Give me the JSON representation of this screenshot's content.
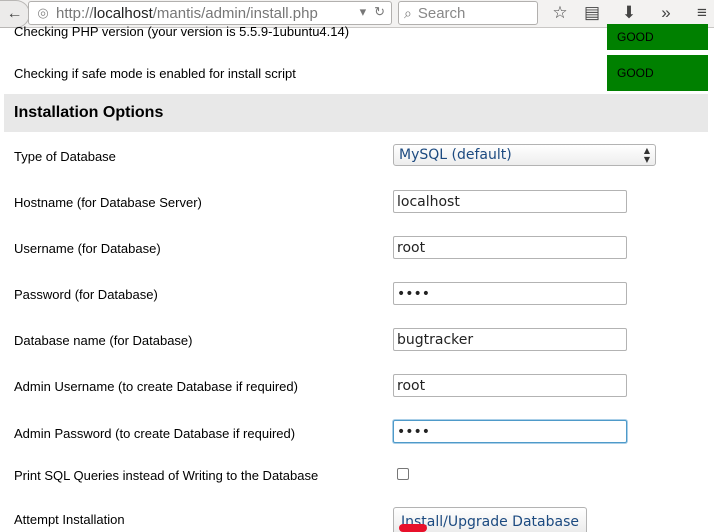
{
  "browser": {
    "url_prefix": "http://",
    "url_host": "localhost",
    "url_path": "/mantis/admin/install.php",
    "search_placeholder": "Search"
  },
  "checks": [
    {
      "label": "Checking PHP version (your version is 5.5.9-1ubuntu4.14)",
      "status": "GOOD"
    },
    {
      "label": "Checking if safe mode is enabled for install script",
      "status": "GOOD"
    }
  ],
  "section": {
    "title": "Installation Options"
  },
  "options": {
    "db_type_label": "Type of Database",
    "db_type_value": "MySQL (default)",
    "hostname_label": "Hostname (for Database Server)",
    "hostname_value": "localhost",
    "username_label": "Username (for Database)",
    "username_value": "root",
    "password_label": "Password (for Database)",
    "password_value": "••••",
    "dbname_label": "Database name (for Database)",
    "dbname_value": "bugtracker",
    "admin_username_label": "Admin Username (to create Database if required)",
    "admin_username_value": "root",
    "admin_password_label": "Admin Password (to create Database if required)",
    "admin_password_value": "••••",
    "print_sql_label": "Print SQL Queries instead of Writing to the Database",
    "attempt_label": "Attempt Installation",
    "install_button": "Install/Upgrade Database"
  },
  "colors": {
    "good": "#008000",
    "section_bg": "#e8e8e8",
    "link_text": "#1c4a80",
    "highlight": "#e8102a"
  }
}
